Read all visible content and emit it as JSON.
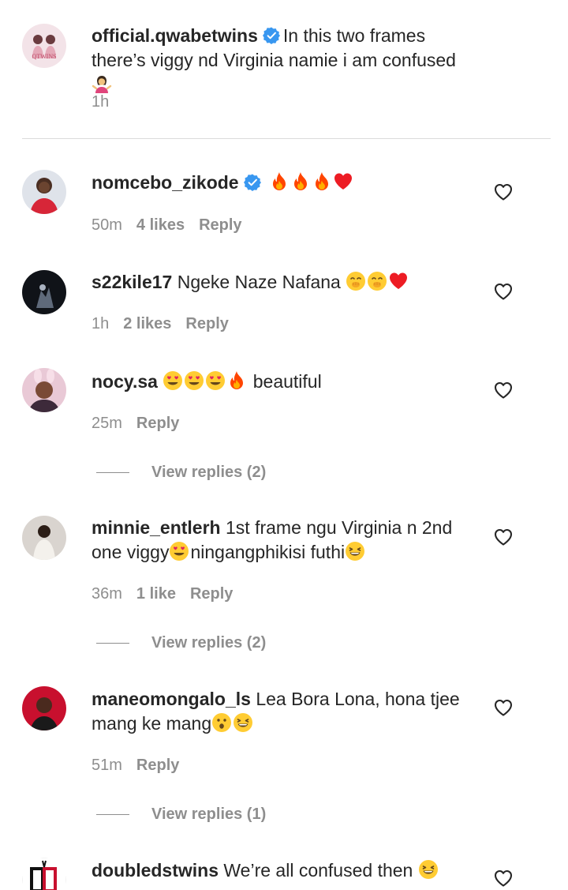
{
  "colors": {
    "accent_blue": "#3897f0",
    "muted": "#8e8e8e",
    "text": "#262626",
    "divider": "#dbdbdb",
    "heart_red": "#ed1c24",
    "fire": "#ff6a00"
  },
  "caption": {
    "username": "official.qwabetwins",
    "text": "In this two frames there’s viggy nd Virginia namie i am confused",
    "time": "1h",
    "emoji": "woman-shrugging-emoji",
    "avatar_text": "QTWINS"
  },
  "comments": [
    {
      "username": "nomcebo_zikode",
      "verified": true,
      "text": "",
      "emojis": [
        "fire-emoji",
        "fire-emoji",
        "fire-emoji",
        "red-heart-emoji"
      ],
      "time": "50m",
      "likes": "4 likes",
      "reply": "Reply"
    },
    {
      "username": "s22kile17",
      "verified": false,
      "text": "Ngeke Naze Nafana",
      "emojis": [
        "hand-over-mouth-emoji",
        "hand-over-mouth-emoji",
        "red-heart-emoji"
      ],
      "time": "1h",
      "likes": "2 likes",
      "reply": "Reply"
    },
    {
      "username": "nocy.sa",
      "verified": false,
      "text": "beautiful",
      "emojis": [
        "heart-eyes-emoji",
        "heart-eyes-emoji",
        "heart-eyes-emoji",
        "fire-emoji"
      ],
      "time": "25m",
      "likes": "",
      "reply": "Reply",
      "view_replies": "View replies (2)"
    },
    {
      "username": "minnie_entlerh",
      "verified": false,
      "text_part1": "1st frame ngu Virginia n 2nd one viggy",
      "text_part2": "ningangphikisi futhi",
      "time": "36m",
      "likes": "1 like",
      "reply": "Reply",
      "view_replies": "View replies (2)"
    },
    {
      "username": "maneomongalo_ls",
      "verified": false,
      "text": "Lea Bora Lona, hona tjee mang ke mang",
      "time": "51m",
      "likes": "",
      "reply": "Reply",
      "view_replies": "View replies (1)"
    },
    {
      "username": "doubledstwins",
      "verified": false,
      "text": "We’re all confused then",
      "time": "",
      "likes": "",
      "reply": ""
    }
  ]
}
